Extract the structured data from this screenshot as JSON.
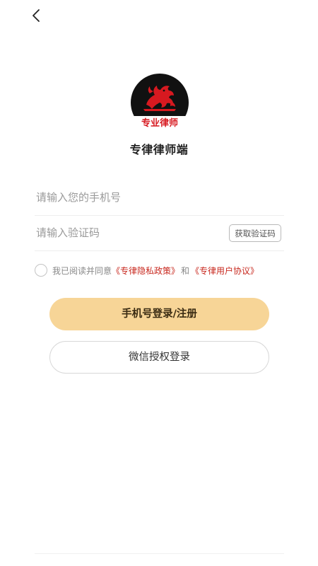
{
  "header": {
    "back_icon": "chevron-left-icon"
  },
  "logo": {
    "text": "专业律师",
    "accent_color": "#d71920",
    "background_color": "#111111"
  },
  "app": {
    "title": "专律律师端"
  },
  "form": {
    "phone_placeholder": "请输入您的手机号",
    "code_placeholder": "请输入验证码",
    "get_code_label": "获取验证码"
  },
  "agreement": {
    "prefix": "我已阅读并同意",
    "privacy_link": "《专律隐私政策》",
    "conjunction": "和",
    "user_link": "《专律用户协议》",
    "checked": false
  },
  "buttons": {
    "phone_login": "手机号登录/注册",
    "wechat_login": "微信授权登录"
  },
  "colors": {
    "primary_button_bg": "#f7d597",
    "link": "#c8291f"
  }
}
